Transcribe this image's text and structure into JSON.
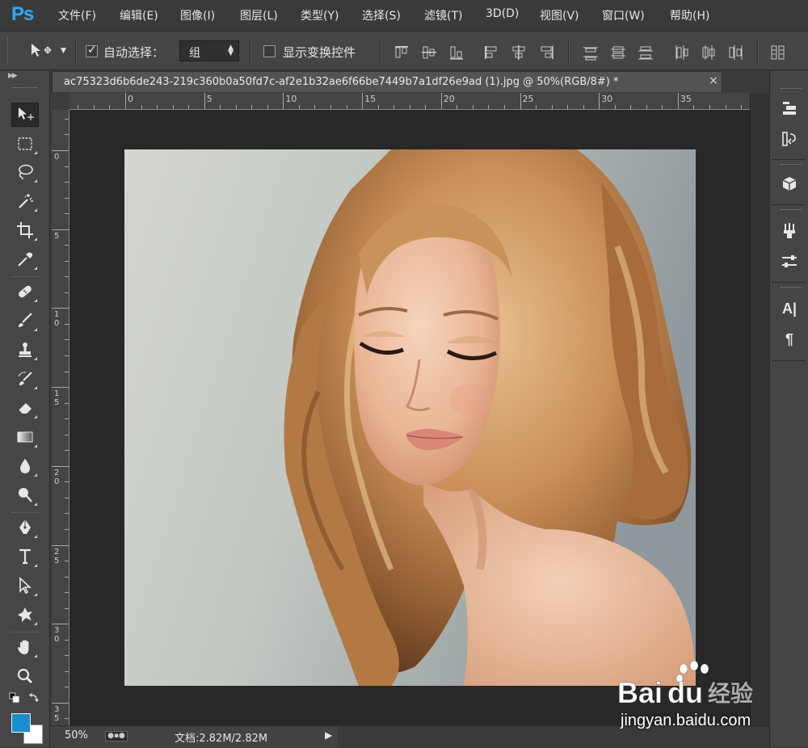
{
  "app": {
    "logo": "Ps"
  },
  "menu": [
    "文件(F)",
    "编辑(E)",
    "图像(I)",
    "图层(L)",
    "类型(Y)",
    "选择(S)",
    "滤镜(T)",
    "3D(D)",
    "视图(V)",
    "窗口(W)",
    "帮助(H)"
  ],
  "options_bar": {
    "auto_select_label": "自动选择：",
    "auto_select_checked": true,
    "auto_select_value": "组",
    "show_transform_label": "显示变换控件",
    "show_transform_checked": false
  },
  "tools": [
    "move-tool",
    "marquee-tool",
    "lasso-tool",
    "quick-select-tool",
    "crop-tool",
    "eyedropper-tool",
    "healing-brush-tool",
    "brush-tool",
    "clone-stamp-tool",
    "history-brush-tool",
    "eraser-tool",
    "gradient-tool",
    "blur-tool",
    "dodge-tool",
    "pen-tool",
    "type-tool",
    "path-selection-tool",
    "custom-shape-tool",
    "hand-tool",
    "zoom-tool"
  ],
  "colors": {
    "foreground": "#1a8fd0",
    "background": "#ffffff",
    "accent": "#31a8ff"
  },
  "document": {
    "tab_title": "ac75323d6b6de243-219c360b0a50fd7c-af2e1b32ae6f66be7449b7a1df26e9ad (1).jpg @ 50%(RGB/8#) *",
    "close_glyph": "×"
  },
  "rulers": {
    "top_labels": [
      "0",
      "5",
      "10",
      "15",
      "20",
      "25",
      "30",
      "35"
    ],
    "left_labels": [
      "0",
      "5",
      "10",
      "15",
      "20",
      "25",
      "30",
      "35"
    ]
  },
  "status": {
    "zoom": "50%",
    "doc_info": "文档:2.82M/2.82M",
    "arrow": "▶"
  },
  "right_dock": {
    "character_label": "A|",
    "paragraph_label": "¶"
  },
  "watermark": {
    "brand": "Bai",
    "brand2": "du",
    "cn": "经验",
    "url": "jingyan.baidu.com"
  }
}
